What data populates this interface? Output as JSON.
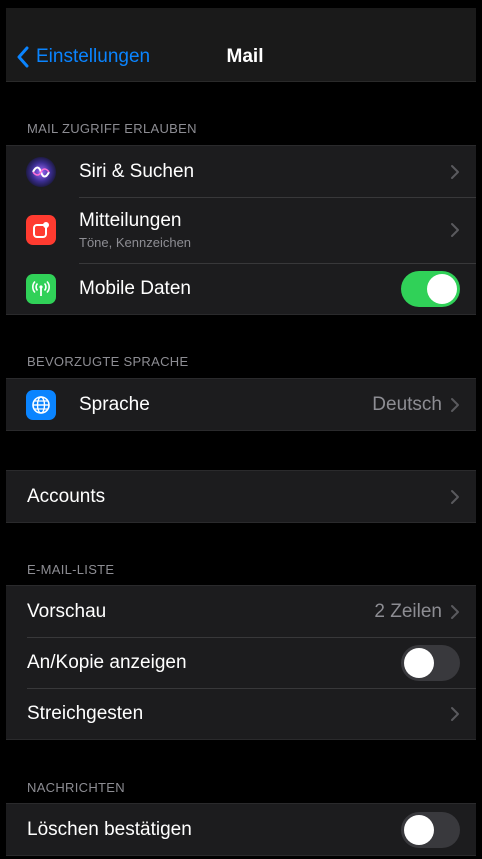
{
  "nav": {
    "back_label": "Einstellungen",
    "title": "Mail"
  },
  "sections": {
    "access_header": "MAIL ZUGRIFF ERLAUBEN",
    "language_header": "BEVORZUGTE SPRACHE",
    "list_header": "E-MAIL-LISTE",
    "messages_header": "NACHRICHTEN"
  },
  "rows": {
    "siri": {
      "label": "Siri & Suchen",
      "icon": "siri-icon"
    },
    "notifications": {
      "label": "Mitteilungen",
      "sublabel": "Töne, Kennzeichen",
      "icon": "notifications-icon"
    },
    "mobile_data": {
      "label": "Mobile Daten",
      "icon": "antenna-icon",
      "toggle": true
    },
    "language": {
      "label": "Sprache",
      "value": "Deutsch",
      "icon": "globe-icon"
    },
    "accounts": {
      "label": "Accounts"
    },
    "preview": {
      "label": "Vorschau",
      "value": "2 Zeilen"
    },
    "show_to_cc": {
      "label": "An/Kopie anzeigen",
      "toggle": false
    },
    "swipe": {
      "label": "Streichgesten"
    },
    "confirm_delete": {
      "label": "Löschen bestätigen",
      "toggle": false
    }
  },
  "colors": {
    "accent": "#0a84ff",
    "toggle_on": "#30d158",
    "notifications_icon": "#ff3b30",
    "mobile_data_icon": "#30d158",
    "language_icon": "#0a84ff"
  }
}
